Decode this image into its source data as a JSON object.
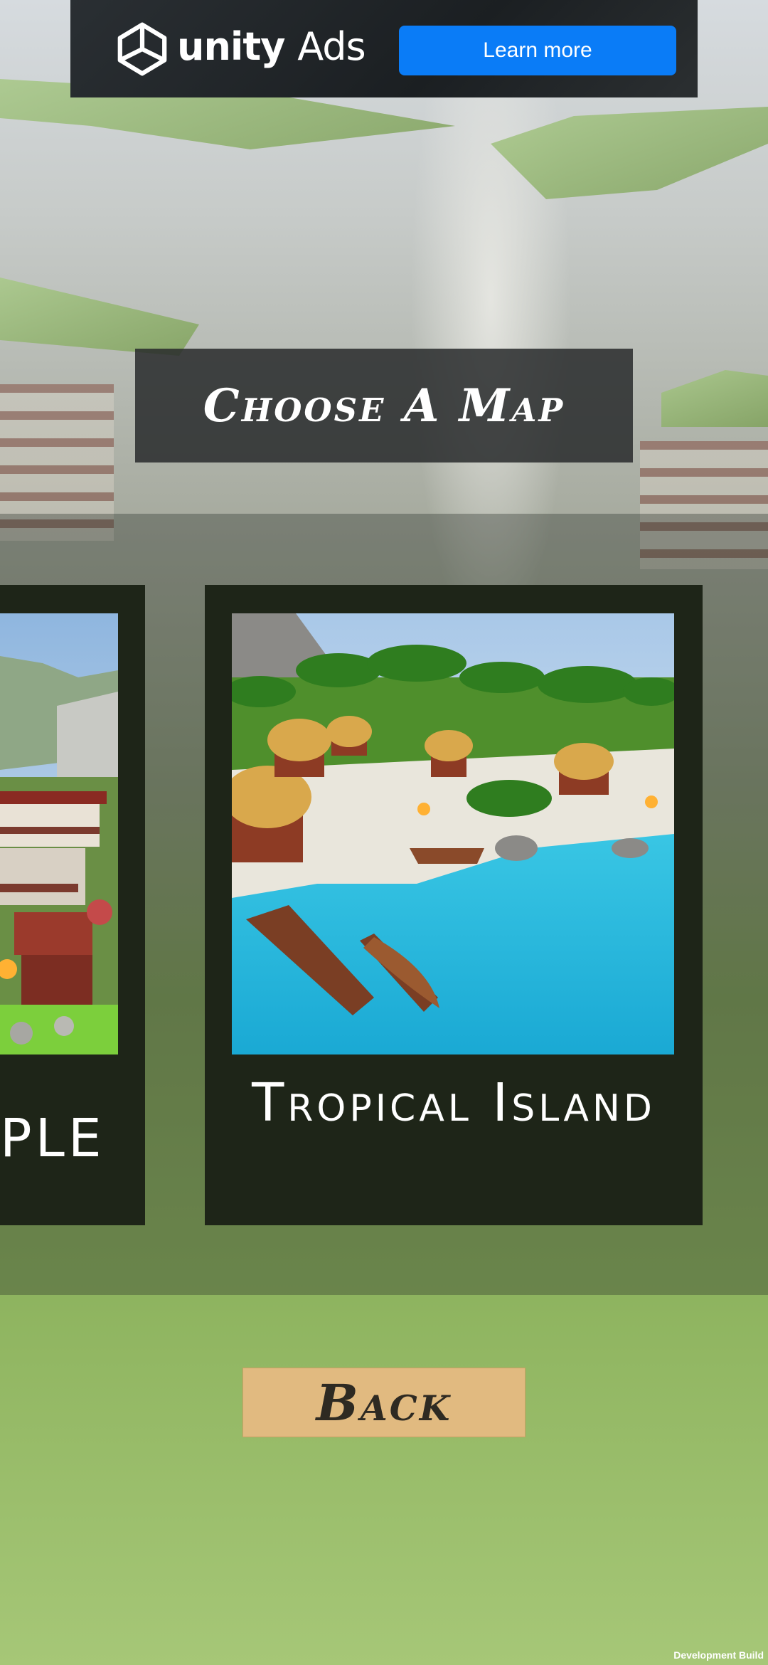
{
  "ad": {
    "brand_bold": "unity",
    "brand_light": "Ads",
    "cta_label": "Learn more"
  },
  "screen": {
    "title": "Choose A Map",
    "back_label": "Back",
    "dev_build": "Development Build"
  },
  "maps": [
    {
      "label": "PLE",
      "selected": false
    },
    {
      "label": "Tropical Island",
      "selected": true
    }
  ],
  "colors": {
    "ad_button": "#0a7cf7",
    "card_bg": "#1e2518",
    "back_button": "#e1ba80"
  }
}
